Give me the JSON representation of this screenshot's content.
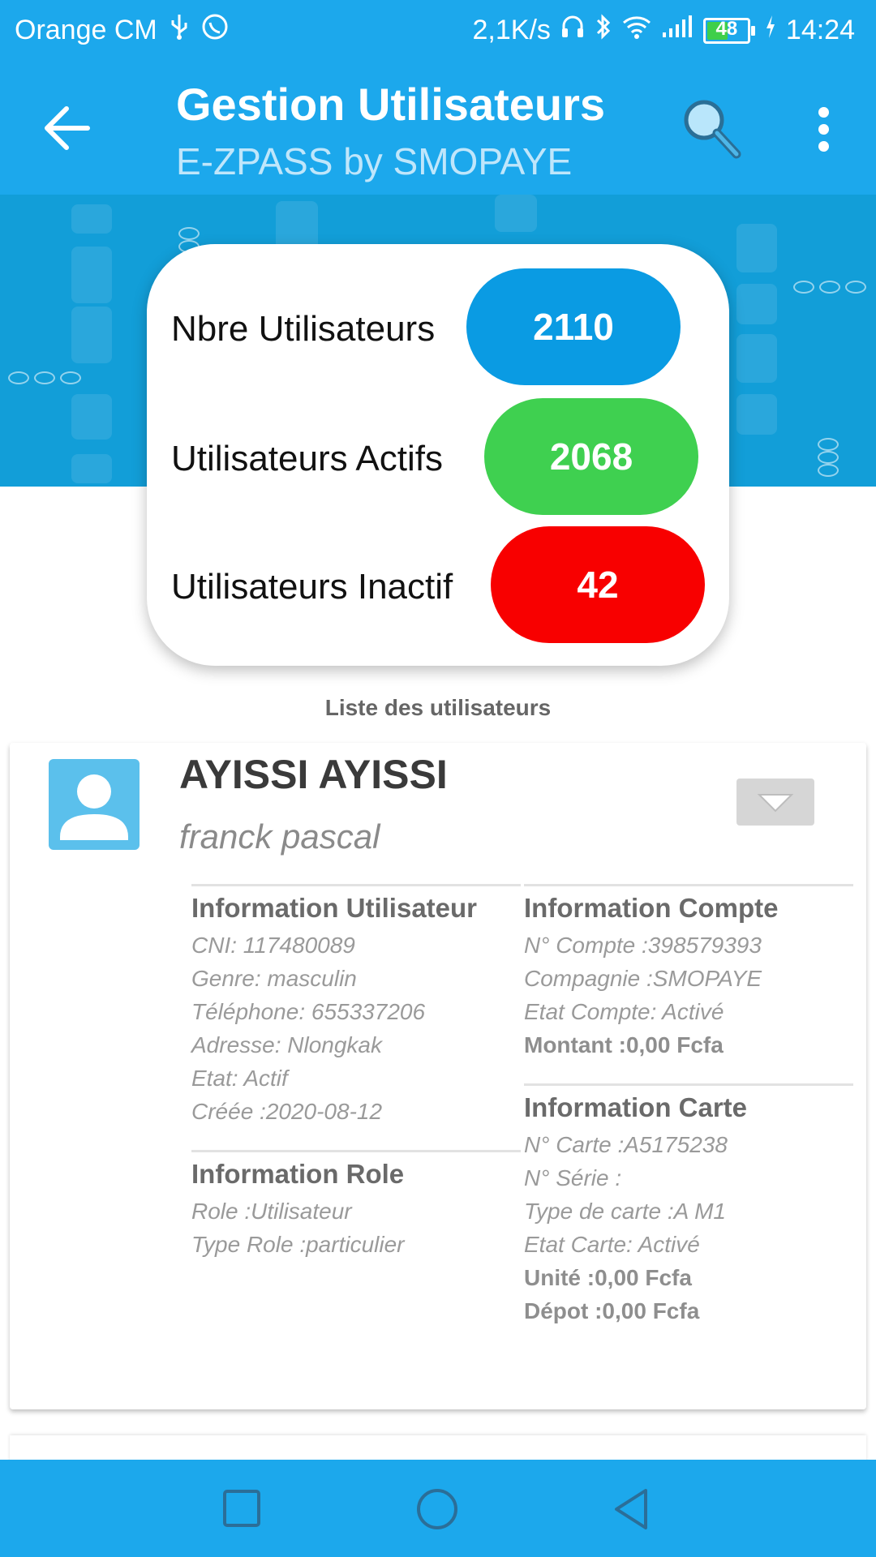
{
  "statusbar": {
    "carrier": "Orange CM",
    "speed": "2,1K/s",
    "battery": "48",
    "time": "14:24"
  },
  "toolbar": {
    "title": "Gestion Utilisateurs",
    "subtitle": "E-ZPASS by SMOPAYE"
  },
  "stats": [
    {
      "label": "Nbre Utilisateurs",
      "value": "2110",
      "color": "#0a9be3"
    },
    {
      "label": "Utilisateurs Actifs",
      "value": "2068",
      "color": "#3fd050"
    },
    {
      "label": "Utilisateurs Inactif",
      "value": "42",
      "color": "#f80000"
    }
  ],
  "list_title": "Liste des utilisateurs",
  "user": {
    "last_name": "AYISSI AYISSI",
    "first_name": "franck pascal",
    "info_user": {
      "title": "Information Utilisateur",
      "lines": [
        "CNI: 117480089",
        "Genre: masculin",
        "Téléphone: 655337206",
        "Adresse: Nlongkak",
        "Etat: Actif",
        "Créée :2020-08-12"
      ]
    },
    "info_role": {
      "title": "Information Role",
      "lines": [
        "Role :Utilisateur",
        "Type Role :particulier"
      ]
    },
    "info_compte": {
      "title": "Information Compte",
      "lines": [
        "N° Compte :398579393",
        "Compagnie :SMOPAYE",
        "Etat Compte: Activé"
      ],
      "bold_lines": [
        "Montant :0,00 Fcfa"
      ]
    },
    "info_carte": {
      "title": "Information Carte",
      "lines": [
        "N° Carte :A5175238",
        "N° Série :",
        "Type de carte :A M1",
        "Etat Carte: Activé"
      ],
      "bold_lines": [
        "Unité :0,00 Fcfa",
        "Dépot :0,00 Fcfa"
      ]
    }
  },
  "icons": {
    "back": "arrow-back-icon",
    "search": "search-icon",
    "menu": "more-vert-icon",
    "expand": "chevron-down-icon",
    "nav": [
      "square-icon",
      "circle-icon",
      "triangle-icon"
    ]
  }
}
